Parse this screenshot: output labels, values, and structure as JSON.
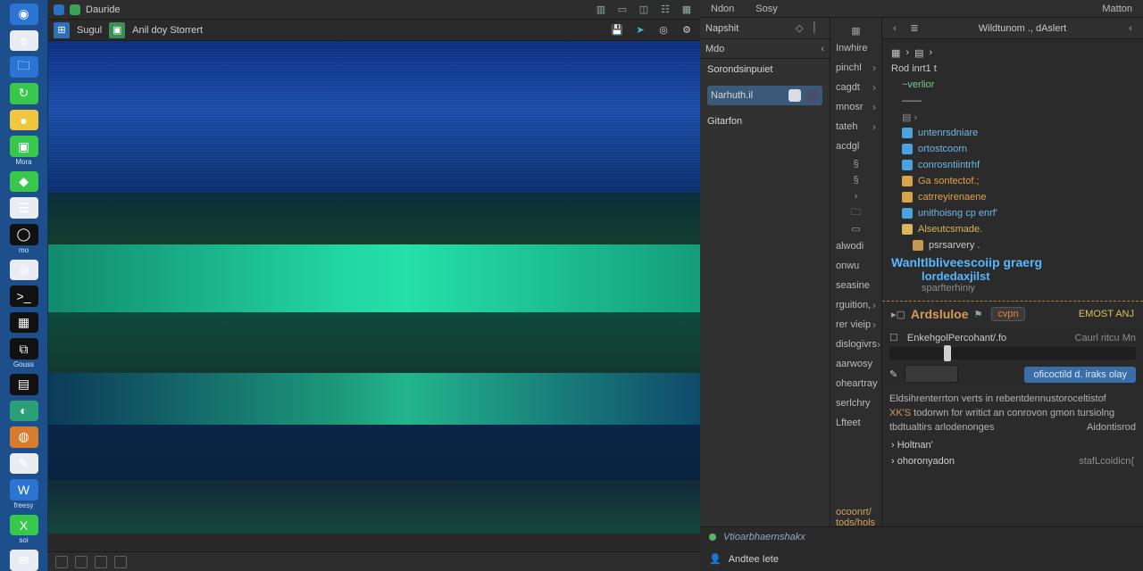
{
  "taskbar": {
    "items": [
      {
        "name": "start",
        "label": "",
        "cls": "tb-blue",
        "glyph": "◉"
      },
      {
        "name": "edge",
        "label": "",
        "cls": "tb-white",
        "glyph": "e"
      },
      {
        "name": "files",
        "label": "",
        "cls": "tb-blue",
        "glyph": "🗀"
      },
      {
        "name": "cycle",
        "label": "",
        "cls": "tb-green",
        "glyph": "↻"
      },
      {
        "name": "apple",
        "label": "",
        "cls": "tb-yellow",
        "glyph": "●"
      },
      {
        "name": "app-a",
        "label": "Mora",
        "cls": "tb-green",
        "glyph": "▣"
      },
      {
        "name": "app-b",
        "label": "",
        "cls": "tb-green",
        "glyph": "◆"
      },
      {
        "name": "app-c",
        "label": "",
        "cls": "tb-white",
        "glyph": "☰"
      },
      {
        "name": "camera",
        "label": "mo",
        "cls": "tb-black",
        "glyph": "◯"
      },
      {
        "name": "disc",
        "label": "",
        "cls": "tb-white",
        "glyph": "◎"
      },
      {
        "name": "term",
        "label": "",
        "cls": "tb-black",
        "glyph": ">_"
      },
      {
        "name": "grid",
        "label": "",
        "cls": "tb-black",
        "glyph": "▦"
      },
      {
        "name": "vs",
        "label": "Gouss",
        "cls": "tb-black",
        "glyph": "⧉"
      },
      {
        "name": "dev",
        "label": "",
        "cls": "tb-black",
        "glyph": "▤"
      },
      {
        "name": "globe",
        "label": "",
        "cls": "tb-teal",
        "glyph": "◐"
      },
      {
        "name": "sec",
        "label": "",
        "cls": "tb-orange",
        "glyph": "◍"
      },
      {
        "name": "paint",
        "label": "",
        "cls": "tb-white",
        "glyph": "✎"
      },
      {
        "name": "word",
        "label": "freesy",
        "cls": "tb-blue",
        "glyph": "W"
      },
      {
        "name": "xl",
        "label": "soi",
        "cls": "tb-green",
        "glyph": "X"
      },
      {
        "name": "msg",
        "label": "",
        "cls": "tb-white",
        "glyph": "✉"
      }
    ]
  },
  "app": {
    "title": "Dauride",
    "toolbar_title1": "Sugul",
    "toolbar_title2": "Anil doy  Storrert",
    "titlebar_icons": [
      "window-list",
      "panel",
      "split",
      "grid",
      "tiles"
    ],
    "toolbar_right": [
      "save",
      "run",
      "target",
      "gear"
    ],
    "status_items": [
      "",
      "",
      "",
      ""
    ]
  },
  "ide": {
    "menu": [
      "Ndon",
      "Sosy",
      "Matton"
    ],
    "panel_a": {
      "header": "Napshit",
      "tab": "Mdo",
      "section1": "Sorondsinpuiet",
      "row_active": "Narhuth.il",
      "section2": "Gitarfon"
    },
    "panel_b": {
      "top": [
        "Inwhire",
        "pinchl",
        "cagdt",
        "mnosr",
        "tateh",
        "acdgl"
      ],
      "mid_glyphs": [
        "§",
        "§",
        "›",
        "🗀",
        "▭"
      ],
      "mid2": [
        "alwodi",
        "onwu",
        "seasine",
        "rguition,",
        "rer vieip",
        "dislogivrs",
        "aarwosy",
        "oheartray",
        "serlchry",
        "Lfteet"
      ],
      "foot": "ocoonrt/ tods/hols"
    },
    "panel_c": {
      "breadcrumb": "Wildtunom ., dAslert",
      "toolstrip": [
        "▦",
        "›",
        "▤",
        "›"
      ],
      "nodes": [
        {
          "t": "Rod inrt1 t",
          "cls": ""
        },
        {
          "t": "~verlior",
          "cls": "green ind1"
        },
        {
          "t": "——",
          "cls": "ind1"
        },
        {
          "t": "▤  ›",
          "cls": "ind1 muted"
        },
        {
          "t": "untenrsdniare",
          "cls": "blue ind1",
          "ic": "#4aa3de"
        },
        {
          "t": "ortostcoorn",
          "cls": "blue ind1",
          "ic": "#4aa3de"
        },
        {
          "t": "conrosntiintrhf",
          "cls": "blue ind1",
          "ic": "#4aa3de"
        },
        {
          "t": "Ga sontectof.;",
          "cls": "orange ind1",
          "ic": "#d6a24a"
        },
        {
          "t": "catrreyirenaene",
          "cls": "orange ind1",
          "ic": "#d6a24a"
        },
        {
          "t": "unithoisng cp enrf'",
          "cls": "blue ind1",
          "ic": "#4aa3de"
        },
        {
          "t": "Alseutcsmade.",
          "cls": "gold ind1",
          "ic": "#d7b75a"
        },
        {
          "t": "psrsarvery .",
          "cls": "ind2",
          "ic": "#c49a53"
        }
      ],
      "headline1": "Wanltlbliveescoiip graerg",
      "headline2": "lordedaxjilst",
      "sub": "sparfterhiniy",
      "module": "Ardsluloe",
      "module_tag": "cvpn",
      "prop_label": "EnkehgolPercohant/.fo",
      "prop_badge": "EMOST ANJ",
      "prop_side": "Caurl ritcu Mn",
      "run_btn": "oficoctild d. iraks olay",
      "field_icon_label": "✎",
      "search_value": "",
      "log_lines": [
        "Eldsihrenterrton verts in   rebentdennustoroceltistof",
        "XK'S todorwn for writict an conrovon gmon tursiolng",
        "tbdtualtirs arlodenonges"
      ],
      "log_right": [
        "",
        "Aidontisrod"
      ],
      "foot_pairs": [
        {
          "l": "Holtnan'",
          "r": ""
        },
        {
          "l": "ohoronyadon",
          "r": "stafLcoidicn{"
        }
      ]
    },
    "bottom": {
      "line1": "Vtioarbhaernshakx",
      "line2": "Andtee Iete"
    }
  }
}
